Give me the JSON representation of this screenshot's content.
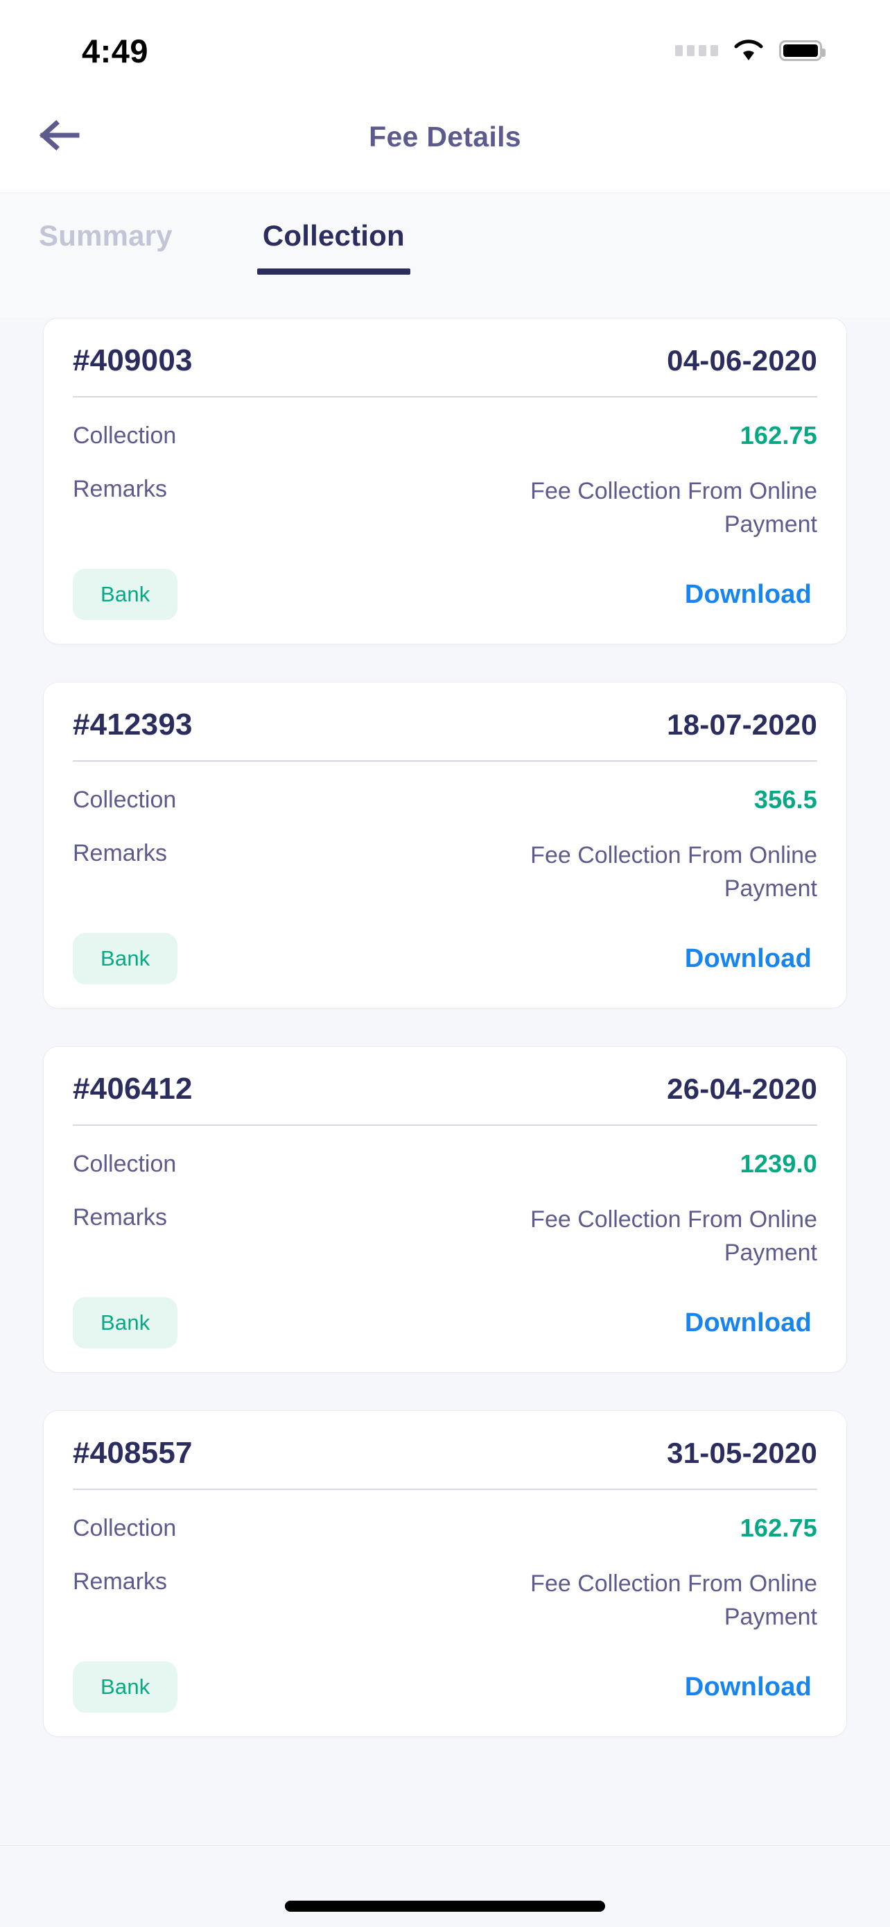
{
  "status_bar": {
    "time": "4:49",
    "signal_icon": "signal-dots-icon",
    "wifi_icon": "wifi-icon",
    "battery_icon": "battery-icon"
  },
  "nav": {
    "back_icon": "arrow-left-icon",
    "title": "Fee Details"
  },
  "tabs": [
    {
      "label": "Summary",
      "active": false
    },
    {
      "label": "Collection",
      "active": true
    }
  ],
  "labels": {
    "collection": "Collection",
    "remarks": "Remarks",
    "download": "Download"
  },
  "colors": {
    "accent_navy": "#2b2d5f",
    "muted_purple": "#5d5a8d",
    "amount_green": "#07a884",
    "badge_bg": "#e6f7f1",
    "link_blue": "#1784ef",
    "tab_inactive": "#c3c5d6",
    "page_bg": "#f6f7fa"
  },
  "cards": [
    {
      "id": "#409003",
      "date": "04-06-2020",
      "collection_label": "Collection",
      "amount": "162.75",
      "remarks_label": "Remarks",
      "remarks": "Fee Collection From Online Payment",
      "badge": "Bank",
      "download": "Download"
    },
    {
      "id": "#412393",
      "date": "18-07-2020",
      "collection_label": "Collection",
      "amount": "356.5",
      "remarks_label": "Remarks",
      "remarks": "Fee Collection From Online Payment",
      "badge": "Bank",
      "download": "Download"
    },
    {
      "id": "#406412",
      "date": "26-04-2020",
      "collection_label": "Collection",
      "amount": "1239.0",
      "remarks_label": "Remarks",
      "remarks": "Fee Collection From Online Payment",
      "badge": "Bank",
      "download": "Download"
    },
    {
      "id": "#408557",
      "date": "31-05-2020",
      "collection_label": "Collection",
      "amount": "162.75",
      "remarks_label": "Remarks",
      "remarks": "Fee Collection From Online Payment",
      "badge": "Bank",
      "download": "Download"
    }
  ]
}
